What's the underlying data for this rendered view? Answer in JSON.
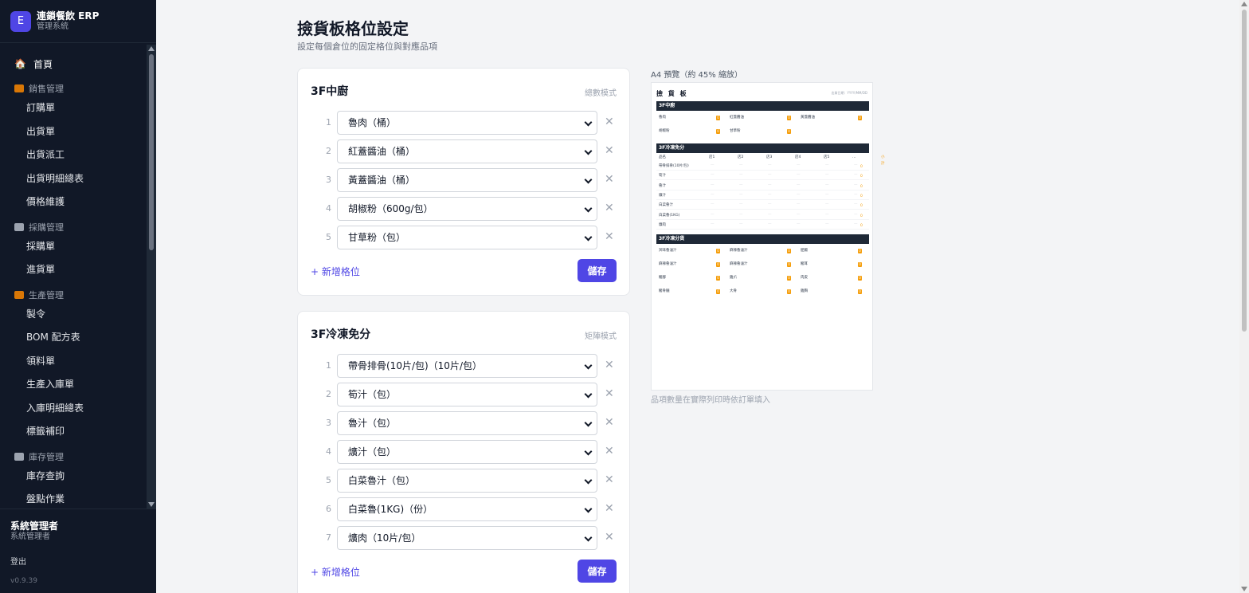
{
  "app": {
    "logo_letter": "E",
    "name": "連鎖餐飲 ERP",
    "subtitle": "管理系統"
  },
  "sidebar": {
    "home": {
      "icon": "home-icon",
      "label": "首頁"
    },
    "sections": [
      {
        "label": "銷售管理",
        "icon": "box-icon",
        "color": "#d97706",
        "items": [
          "訂購單",
          "出貨單",
          "出貨派工",
          "出貨明細總表",
          "價格維護"
        ]
      },
      {
        "label": "採購管理",
        "icon": "cart-icon",
        "color": "#9ca3af",
        "items": [
          "採購單",
          "進貨單"
        ]
      },
      {
        "label": "生產管理",
        "icon": "factory-icon",
        "color": "#d97706",
        "items": [
          "製令",
          "BOM 配方表",
          "領料單",
          "生產入庫單",
          "入庫明細總表",
          "標籤補印"
        ]
      },
      {
        "label": "庫存管理",
        "icon": "warehouse-icon",
        "color": "#9ca3af",
        "items": [
          "庫存查詢",
          "盤點作業"
        ]
      }
    ]
  },
  "user": {
    "name": "系統管理者",
    "role": "系統管理者",
    "logout": "登出",
    "version": "v0.9.39"
  },
  "page": {
    "title": "撿貨板格位設定",
    "subtitle": "設定每個倉位的固定格位與對應品項"
  },
  "cards": [
    {
      "title": "3F中廚",
      "mode": "總數模式",
      "slots": [
        {
          "num": "1",
          "value": "魯肉（桶）"
        },
        {
          "num": "2",
          "value": "紅蓋醬油（桶）"
        },
        {
          "num": "3",
          "value": "黃蓋醬油（桶）"
        },
        {
          "num": "4",
          "value": "胡椒粉（600g/包）"
        },
        {
          "num": "5",
          "value": "甘草粉（包）"
        }
      ],
      "add_label": "+ 新增格位",
      "save_label": "儲存"
    },
    {
      "title": "3F冷凍免分",
      "mode": "矩陣模式",
      "slots": [
        {
          "num": "1",
          "value": "帶骨排骨(10片/包)（10片/包）"
        },
        {
          "num": "2",
          "value": "筍汁（包）"
        },
        {
          "num": "3",
          "value": "魯汁（包）"
        },
        {
          "num": "4",
          "value": "爌汁（包）"
        },
        {
          "num": "5",
          "value": "白菜魯汁（包）"
        },
        {
          "num": "6",
          "value": "白菜魯(1KG)（份）"
        },
        {
          "num": "7",
          "value": "爌肉（10片/包）"
        }
      ],
      "add_label": "+ 新增格位",
      "save_label": "儲存"
    }
  ],
  "preview": {
    "label": "A4 預覽（約 45% 縮放）",
    "note": "品項數量在實際列印時依訂單填入",
    "doc_title": "撿 貨 板",
    "doc_date": "出貨日期：YYYY/MM/DD",
    "sections": [
      {
        "title": "3F中廚",
        "cells": [
          "魯肉",
          "紅蓋醬油",
          "黃蓋醬油",
          "胡椒粉",
          "甘草粉"
        ],
        "units": [
          "桶",
          "桶",
          "桶",
          "600g/包",
          "包"
        ]
      },
      {
        "title": "3F冷凍免分",
        "head": [
          "品名",
          "店1",
          "店2",
          "店3",
          "店4",
          "店5",
          "…",
          "小計"
        ],
        "rows": [
          "帶骨排骨(10片/包)",
          "筍汁",
          "魯汁",
          "爌汁",
          "白菜魯汁",
          "白菜魯(1KG)",
          "爌肉"
        ]
      },
      {
        "title": "3F冷凍分貨",
        "cells": [
          "冥味魯滷汁",
          "麻辣魯滷汁",
          "肥腸",
          "麻辣魯滷汁",
          "麻辣魯滷汁",
          "豬耳",
          "豬腳",
          "雞爪",
          "肉皮",
          "豬骨髓",
          "大骨",
          "雞胸"
        ]
      }
    ]
  }
}
